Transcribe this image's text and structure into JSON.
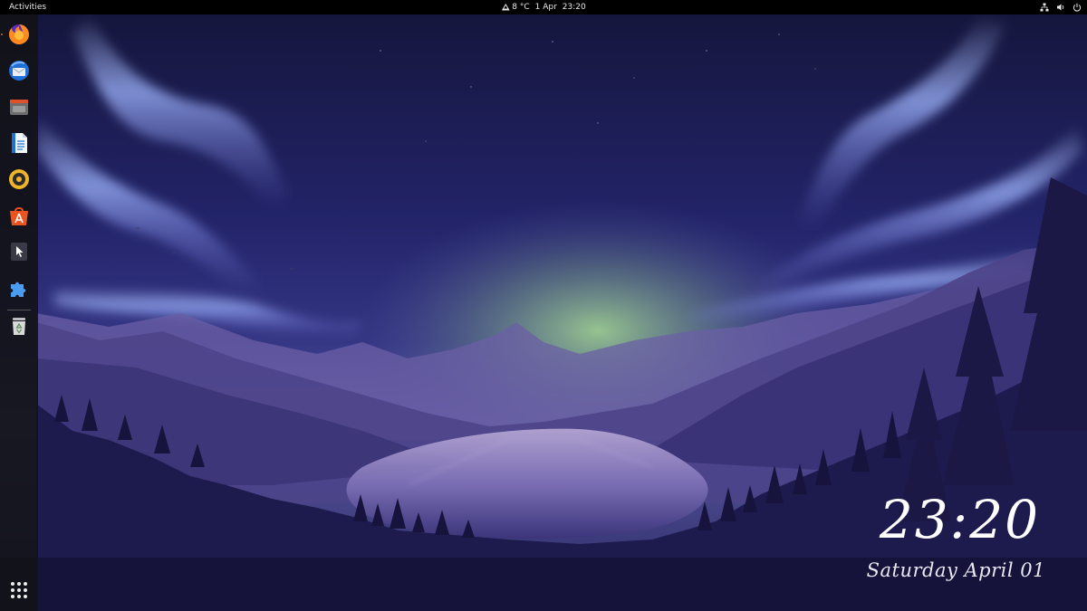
{
  "topbar": {
    "activities_label": "Activities",
    "weather_temp": "8 °C",
    "date": "1 Apr",
    "time": "23:20",
    "icons": [
      "network-icon",
      "volume-icon",
      "power-icon"
    ]
  },
  "dock": {
    "apps": [
      {
        "name": "Firefox",
        "icon": "firefox-icon"
      },
      {
        "name": "Thunderbird",
        "icon": "thunderbird-icon"
      },
      {
        "name": "Files",
        "icon": "files-icon"
      },
      {
        "name": "LibreOffice Writer",
        "icon": "writer-icon"
      },
      {
        "name": "Rhythmbox",
        "icon": "rhythmbox-icon"
      },
      {
        "name": "Ubuntu Software",
        "icon": "software-icon"
      },
      {
        "name": "Screenshot",
        "icon": "screenshot-icon"
      },
      {
        "name": "Extensions",
        "icon": "extensions-icon"
      },
      {
        "name": "Trash",
        "icon": "trash-icon"
      }
    ],
    "show_apps_icon": "show-apps-grid-icon"
  },
  "desktop_clock": {
    "time": "23:20",
    "date": "Saturday April 01"
  },
  "colors": {
    "sky_top": "#191a4a",
    "sky_mid": "#2a2c7a",
    "aurora": "#8fb0ff",
    "horizon_glow": "#9bd18a",
    "mountains": "#4a3f86",
    "forest": "#16143d",
    "topbar": "#000000",
    "dock": "#121218"
  }
}
